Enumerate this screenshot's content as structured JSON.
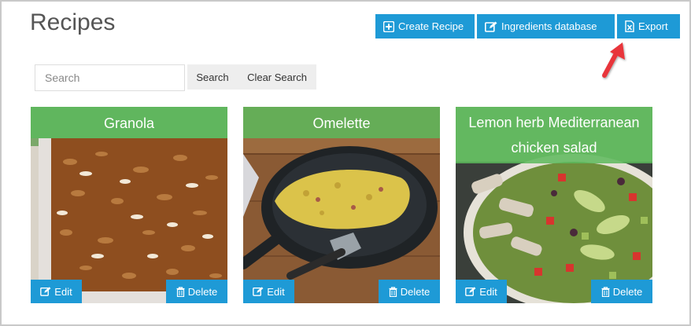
{
  "page": {
    "title": "Recipes"
  },
  "toolbar": {
    "create_label": "Create Recipe",
    "ingredients_label": "Ingredients database",
    "export_label": "Export"
  },
  "search": {
    "placeholder": "Search",
    "search_label": "Search",
    "clear_label": "Clear Search"
  },
  "recipes": [
    {
      "title": "Granola",
      "edit_label": "Edit",
      "delete_label": "Delete"
    },
    {
      "title": "Omelette",
      "edit_label": "Edit",
      "delete_label": "Delete"
    },
    {
      "title": "Lemon herb Mediterranean chicken salad",
      "edit_label": "Edit",
      "delete_label": "Delete"
    }
  ],
  "colors": {
    "primary": "#1e9ad6",
    "title_overlay": "#5cb85c",
    "annotation_arrow": "#e8343a"
  },
  "icons": {
    "create": "plus-square-icon",
    "ingredients": "edit-icon",
    "export": "excel-file-icon",
    "edit": "edit-icon",
    "delete": "trash-icon"
  }
}
